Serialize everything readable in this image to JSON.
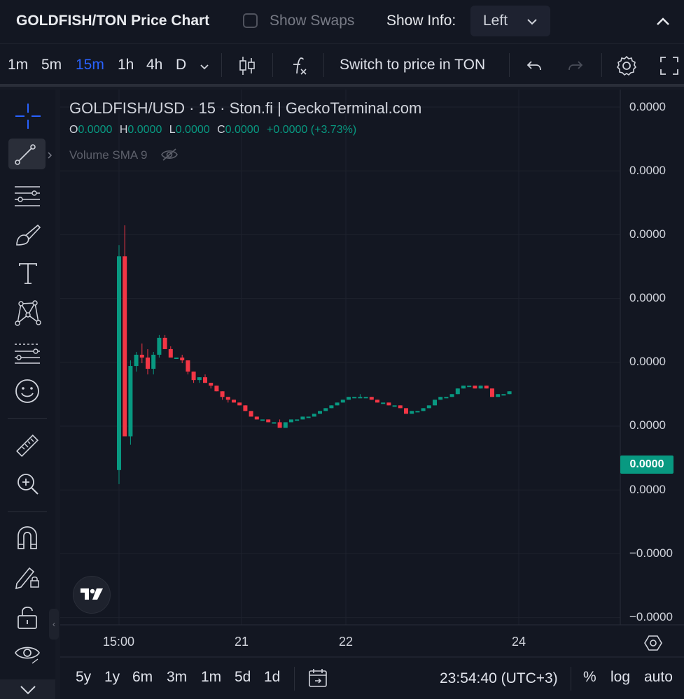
{
  "header": {
    "title": "GOLDFISH/TON Price Chart",
    "show_swaps_label": "Show Swaps",
    "show_info_label": "Show Info:",
    "show_info_value": "Left"
  },
  "toolbar": {
    "timeframes": [
      {
        "label": "1m"
      },
      {
        "label": "5m"
      },
      {
        "label": "15m",
        "active": true
      },
      {
        "label": "1h"
      },
      {
        "label": "4h"
      },
      {
        "label": "D"
      }
    ],
    "switch_label": "Switch to price in TON",
    "icons": [
      "chevron-down-icon",
      "candlestick-icon",
      "indicators-icon",
      "undo-icon",
      "redo-icon",
      "settings-icon",
      "fullscreen-icon"
    ]
  },
  "left_toolbar": {
    "tools": [
      "crosshair-icon",
      "trend-line-icon",
      "horizontal-lines-icon",
      "brush-icon",
      "text-icon",
      "pattern-icon",
      "forecast-icon",
      "emoji-icon",
      "ruler-icon",
      "zoom-in-icon",
      "magnet-icon",
      "lock-drawing-icon",
      "unlock-icon",
      "eye-icon",
      "chevron-down-icon"
    ]
  },
  "legend": {
    "symbol_line": "GOLDFISH/USD · 15 · Ston.fi | GeckoTerminal.com",
    "ohlc": {
      "o_label": "O",
      "o": "0.0000",
      "h_label": "H",
      "h": "0.0000",
      "l_label": "L",
      "l": "0.0000",
      "c_label": "C",
      "c": "0.0000",
      "change": "+0.0000 (+3.73%)"
    },
    "volume": "Volume SMA 9"
  },
  "price_axis": {
    "labels": [
      "0.0000",
      "0.0000",
      "0.0000",
      "0.0000",
      "0.0000",
      "0.0000",
      "0.0000",
      "−0.0000",
      "−0.0000"
    ],
    "last_price": "0.0000"
  },
  "time_axis": {
    "labels": [
      "15:00",
      "21",
      "22",
      "24"
    ]
  },
  "bottom_bar": {
    "ranges": [
      "5y",
      "1y",
      "6m",
      "3m",
      "1m",
      "5d",
      "1d"
    ],
    "clock": "23:54:40 (UTC+3)",
    "percent": "%",
    "log": "log",
    "auto": "auto"
  },
  "colors": {
    "up": "#089981",
    "down": "#f23645",
    "accent": "#2962ff",
    "background": "#131722"
  },
  "chart_data": {
    "type": "candlestick",
    "note_units": "relative price index (axis labels all round to 0.0000)",
    "x_labels": [
      "15:00",
      "21",
      "22",
      "24"
    ],
    "series": [
      {
        "candles": [
          [
            0.1,
            0.9,
            0.05,
            0.86
          ],
          [
            0.86,
            0.97,
            0.79,
            0.22
          ],
          [
            0.22,
            0.49,
            0.19,
            0.47
          ],
          [
            0.47,
            0.52,
            0.45,
            0.51
          ],
          [
            0.51,
            0.55,
            0.48,
            0.5
          ],
          [
            0.5,
            0.53,
            0.44,
            0.46
          ],
          [
            0.46,
            0.52,
            0.44,
            0.51
          ],
          [
            0.51,
            0.58,
            0.5,
            0.57
          ],
          [
            0.57,
            0.58,
            0.53,
            0.53
          ],
          [
            0.53,
            0.54,
            0.5,
            0.5
          ],
          [
            0.5,
            0.5,
            0.5,
            0.5
          ],
          [
            0.5,
            0.51,
            0.48,
            0.49
          ],
          [
            0.49,
            0.49,
            0.44,
            0.45
          ],
          [
            0.45,
            0.45,
            0.41,
            0.42
          ],
          [
            0.42,
            0.43,
            0.41,
            0.43
          ],
          [
            0.43,
            0.44,
            0.41,
            0.41
          ],
          [
            0.41,
            0.41,
            0.39,
            0.4
          ],
          [
            0.4,
            0.4,
            0.38,
            0.38
          ],
          [
            0.38,
            0.38,
            0.35,
            0.36
          ],
          [
            0.36,
            0.36,
            0.34,
            0.35
          ],
          [
            0.35,
            0.35,
            0.34,
            0.34
          ],
          [
            0.34,
            0.34,
            0.33,
            0.33
          ],
          [
            0.33,
            0.33,
            0.31,
            0.31
          ],
          [
            0.31,
            0.31,
            0.29,
            0.29
          ],
          [
            0.29,
            0.29,
            0.28,
            0.28
          ],
          [
            0.28,
            0.28,
            0.28,
            0.28
          ],
          [
            0.28,
            0.28,
            0.27,
            0.27
          ],
          [
            0.27,
            0.27,
            0.27,
            0.27
          ],
          [
            0.27,
            0.28,
            0.26,
            0.25
          ],
          [
            0.25,
            0.27,
            0.25,
            0.27
          ],
          [
            0.27,
            0.28,
            0.27,
            0.28
          ],
          [
            0.28,
            0.28,
            0.28,
            0.28
          ],
          [
            0.28,
            0.29,
            0.28,
            0.29
          ],
          [
            0.29,
            0.29,
            0.29,
            0.29
          ],
          [
            0.29,
            0.3,
            0.29,
            0.3
          ],
          [
            0.3,
            0.31,
            0.3,
            0.31
          ],
          [
            0.31,
            0.32,
            0.31,
            0.32
          ],
          [
            0.32,
            0.33,
            0.32,
            0.33
          ],
          [
            0.33,
            0.34,
            0.33,
            0.34
          ],
          [
            0.34,
            0.35,
            0.34,
            0.35
          ],
          [
            0.35,
            0.36,
            0.35,
            0.36
          ],
          [
            0.36,
            0.36,
            0.36,
            0.36
          ],
          [
            0.36,
            0.37,
            0.36,
            0.36
          ],
          [
            0.36,
            0.36,
            0.36,
            0.36
          ],
          [
            0.36,
            0.36,
            0.35,
            0.35
          ],
          [
            0.35,
            0.35,
            0.34,
            0.34
          ],
          [
            0.34,
            0.34,
            0.34,
            0.34
          ],
          [
            0.34,
            0.34,
            0.33,
            0.33
          ],
          [
            0.33,
            0.33,
            0.33,
            0.33
          ],
          [
            0.33,
            0.33,
            0.32,
            0.32
          ],
          [
            0.32,
            0.32,
            0.3,
            0.3
          ],
          [
            0.3,
            0.31,
            0.3,
            0.31
          ],
          [
            0.31,
            0.31,
            0.31,
            0.31
          ],
          [
            0.31,
            0.32,
            0.31,
            0.32
          ],
          [
            0.32,
            0.33,
            0.32,
            0.33
          ],
          [
            0.33,
            0.35,
            0.33,
            0.35
          ],
          [
            0.35,
            0.36,
            0.35,
            0.36
          ],
          [
            0.36,
            0.36,
            0.36,
            0.36
          ],
          [
            0.36,
            0.37,
            0.36,
            0.37
          ],
          [
            0.37,
            0.39,
            0.37,
            0.39
          ],
          [
            0.39,
            0.4,
            0.39,
            0.4
          ],
          [
            0.4,
            0.4,
            0.4,
            0.4
          ],
          [
            0.4,
            0.4,
            0.39,
            0.39
          ],
          [
            0.39,
            0.4,
            0.39,
            0.4
          ],
          [
            0.4,
            0.4,
            0.39,
            0.39
          ],
          [
            0.39,
            0.39,
            0.36,
            0.36
          ],
          [
            0.36,
            0.37,
            0.36,
            0.37
          ],
          [
            0.37,
            0.37,
            0.37,
            0.37
          ],
          [
            0.37,
            0.38,
            0.37,
            0.38
          ]
        ]
      }
    ],
    "grid": true
  }
}
